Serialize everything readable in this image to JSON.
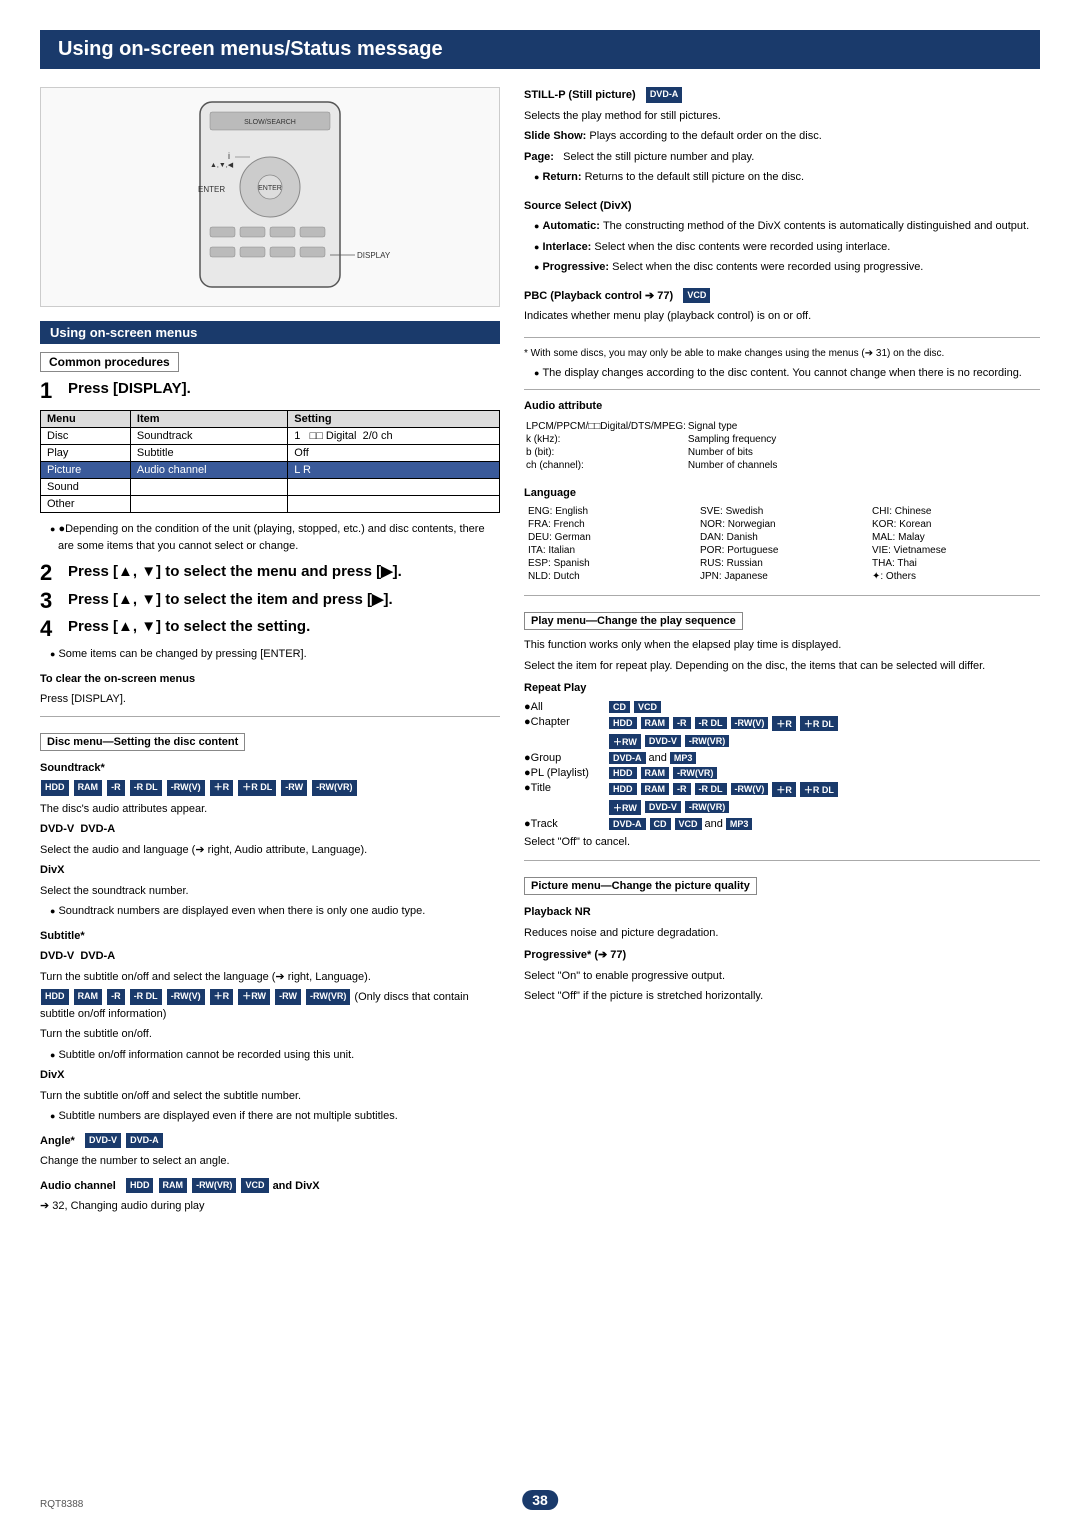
{
  "page": {
    "title": "Using on-screen menus/Status message",
    "page_number": "38",
    "rqt": "RQT8388"
  },
  "left": {
    "section_title": "Using on-screen menus",
    "common_procedures_label": "Common procedures",
    "steps": [
      {
        "num": "1",
        "text": "Press [DISPLAY]."
      },
      {
        "num": "2",
        "text": "Press [▲, ▼] to select the menu and press [▶]."
      },
      {
        "num": "3",
        "text": "Press [▲, ▼] to select the item and press [▶]."
      },
      {
        "num": "4",
        "text": "Press [▲, ▼] to select the setting."
      }
    ],
    "step4_note": "●Some items can be changed by pressing [ENTER].",
    "clear_note_title": "To clear the on-screen menus",
    "clear_note_text": "Press [DISPLAY].",
    "osd_table": {
      "headers": [
        "Menu",
        "Item",
        "Setting"
      ],
      "rows": [
        [
          "Disc",
          "Soundtrack",
          "1  □□ Digital  2/0 ch"
        ],
        [
          "Play",
          "Subtitle",
          "Off"
        ],
        [
          "Picture",
          "Audio channel",
          "L R"
        ],
        [
          "Sound",
          "",
          ""
        ],
        [
          "Other",
          "",
          ""
        ]
      ],
      "highlight_row": 2
    },
    "osd_note": "●Depending on the condition of the unit (playing, stopped, etc.) and disc contents, there are some items that you cannot select or change.",
    "disc_menu_title": "Disc menu—Setting the disc content",
    "soundtrack_title": "Soundtrack*",
    "soundtrack_badges": [
      "HDD",
      "RAM",
      "-R",
      "-R DL",
      "-RW(V)",
      "＋R",
      "＋R DL",
      "-RW",
      "-RW(VR)"
    ],
    "soundtrack_note": "The disc's audio attributes appear.",
    "dvdv_dvda_title": "DVD-V  DVD-A",
    "dvdv_dvda_text": "Select the audio and language (➔ right, Audio attribute, Language).",
    "divx_title": "DivX",
    "divx_text": "Select the soundtrack number.",
    "soundtrack_sub1": "●Soundtrack numbers are displayed even when there is only one audio type.",
    "subtitle_title": "Subtitle*",
    "dvdv_dvda_sub": "DVD-V  DVD-A",
    "subtitle_dvdvdvda_text": "Turn the subtitle on/off and select the language (➔ right, Language).",
    "subtitle_hdd_badges": [
      "HDD",
      "RAM",
      "-R",
      "-R DL",
      "-RW(V)",
      "＋R",
      "＋RW",
      "-RW",
      "-RW(VR)"
    ],
    "subtitle_hdd_note": "(Only discs that contain subtitle on/off information)",
    "subtitle_hdd_text": "Turn the subtitle on/off.",
    "subtitle_note1": "●Subtitle on/off information cannot be recorded using this unit.",
    "subtitle_divx_title": "DivX",
    "subtitle_divx_text": "Turn the subtitle on/off and select the subtitle number.",
    "subtitle_note2": "●Subtitle numbers are displayed even if there are not multiple subtitles.",
    "angle_title": "Angle*  DVD-V  DVD-A",
    "angle_text": "Change the number to select an angle.",
    "audio_channel_title": "Audio channel  HDD  RAM  -RW(VR)  VCD  and DivX",
    "audio_channel_text": "➔ 32, Changing audio during play"
  },
  "right": {
    "still_p_title": "STILL-P (Still picture)  DVD-A",
    "still_p_text": "Selects the play method for still pictures.",
    "slide_show": "Slide Show: Plays according to the default order on the disc.",
    "page_label": "Page:",
    "page_text": "Select the still picture number and play.",
    "return_label": "●Return:",
    "return_text": "Returns to the default still picture on the disc.",
    "source_select_title": "Source Select (DivX)",
    "source_select_auto": "●Automatic: The constructing method of the DivX contents is automatically distinguished and output.",
    "source_select_interlace": "●Interlace: Select when the disc contents were recorded using interlace.",
    "source_select_progressive": "●Progressive: Select when the disc contents were recorded using progressive.",
    "pbc_title": "PBC (Playback control ➔ 77)  VCD",
    "pbc_text": "Indicates whether menu play (playback control) is on or off.",
    "asterisk_note": "* With some discs, you may only be able to make changes using the menus (➔ 31) on the disc.",
    "display_note": "●The display changes according to the disc content. You cannot change when there is no recording.",
    "audio_attr_title": "Audio attribute",
    "audio_attr_rows": [
      [
        "LPCM/PPCM/□□Digital/DTS/MPEG:",
        "Signal type"
      ],
      [
        "k (kHz):",
        "Sampling frequency"
      ],
      [
        "b (bit):",
        "Number of bits"
      ],
      [
        "ch (channel):",
        "Number of channels"
      ]
    ],
    "language_title": "Language",
    "languages": [
      [
        "ENG: English",
        "SVE: Swedish",
        "CHI: Chinese"
      ],
      [
        "FRA: French",
        "NOR: Norwegian",
        "KOR: Korean"
      ],
      [
        "DEU: German",
        "DAN: Danish",
        "MAL: Malay"
      ],
      [
        "ITA: Italian",
        "POR: Portuguese",
        "VIE: Vietnamese"
      ],
      [
        "ESP: Spanish",
        "RUS: Russian",
        "THA: Thai"
      ],
      [
        "NLD: Dutch",
        "JPN: Japanese",
        "✦: Others"
      ]
    ],
    "play_menu_title": "Play menu—Change the play sequence",
    "play_menu_note1": "This function works only when the elapsed play time is displayed.",
    "play_menu_note2": "Select the item for repeat play. Depending on the disc, the items that can be selected will differ.",
    "repeat_play_title": "Repeat Play",
    "repeat_rows": [
      {
        "label": "●All",
        "badges": [
          "CD",
          "VCD"
        ]
      },
      {
        "label": "●Chapter",
        "badges": [
          "HDD",
          "RAM",
          "-R",
          "-R DL",
          "-RW(V)",
          "＋R",
          "＋R DL"
        ]
      },
      {
        "label": "",
        "badges": [
          "＋RW",
          "DVD-V",
          "-RW(VR)"
        ]
      },
      {
        "label": "●Group",
        "badges": [
          "DVD-A",
          "and",
          "MP3"
        ]
      },
      {
        "label": "●PL (Playlist)",
        "badges": [
          "HDD",
          "RAM",
          "-RW(VR)"
        ]
      },
      {
        "label": "●Title",
        "badges": [
          "HDD",
          "RAM",
          "-R",
          "-R DL",
          "-RW(V)",
          "＋R",
          "＋R DL"
        ]
      },
      {
        "label": "",
        "badges": [
          "＋RW",
          "DVD-V",
          "-RW(VR)"
        ]
      },
      {
        "label": "●Track",
        "badges": [
          "DVD-A",
          "CD",
          "VCD",
          "and",
          "MP3"
        ]
      }
    ],
    "select_off": "Select \"Off\" to cancel.",
    "picture_menu_title": "Picture menu—Change the picture quality",
    "playback_nr_title": "Playback NR",
    "playback_nr_text": "Reduces noise and picture degradation.",
    "progressive_title": "Progressive* (➔ 77)",
    "progressive_text1": "Select \"On\" to enable progressive output.",
    "progressive_text2": "Select \"Off\" if the picture is stretched horizontally."
  }
}
